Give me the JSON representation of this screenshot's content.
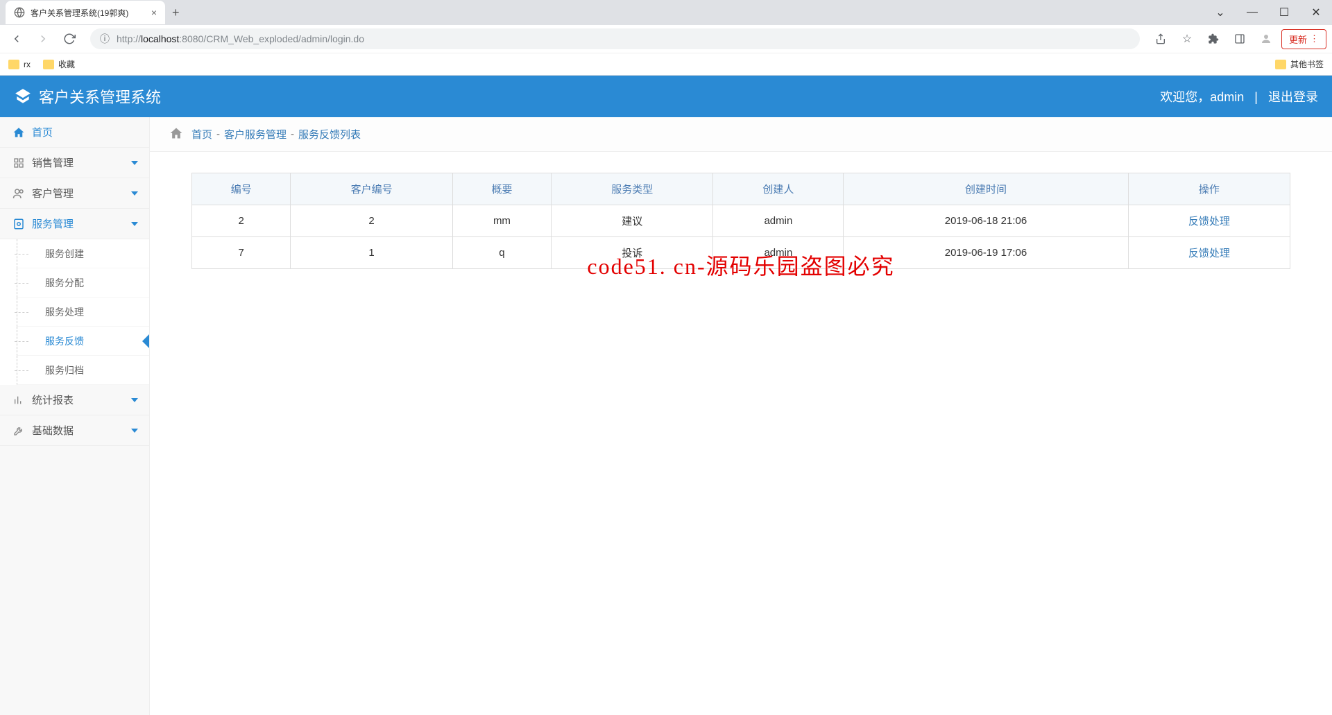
{
  "browser": {
    "tab_title": "客户关系管理系统(19郭爽)",
    "url_prefix": "http://",
    "url_host": "localhost",
    "url_port": ":8080",
    "url_path": "/CRM_Web_exploded/admin/login.do",
    "update_label": "更新",
    "bookmarks": [
      "rx",
      "收藏"
    ],
    "other_bookmarks": "其他书签"
  },
  "header": {
    "app_title": "客户关系管理系统",
    "welcome": "欢迎您，",
    "username": "admin",
    "logout": "退出登录"
  },
  "sidebar": {
    "home": "首页",
    "sales": "销售管理",
    "customer": "客户管理",
    "service": "服务管理",
    "service_sub": {
      "create": "服务创建",
      "assign": "服务分配",
      "process": "服务处理",
      "feedback": "服务反馈",
      "archive": "服务归档"
    },
    "stats": "统计报表",
    "basic": "基础数据"
  },
  "breadcrumb": {
    "home": "首页",
    "section": "客户服务管理",
    "page": "服务反馈列表"
  },
  "table": {
    "headers": {
      "id": "编号",
      "customer_id": "客户编号",
      "summary": "概要",
      "type": "服务类型",
      "creator": "创建人",
      "created_at": "创建时间",
      "action": "操作"
    },
    "rows": [
      {
        "id": "2",
        "customer_id": "2",
        "summary": "mm",
        "type": "建议",
        "creator": "admin",
        "created_at": "2019-06-18 21:06",
        "action": "反馈处理"
      },
      {
        "id": "7",
        "customer_id": "1",
        "summary": "q",
        "type": "投诉",
        "creator": "admin",
        "created_at": "2019-06-19 17:06",
        "action": "反馈处理"
      }
    ]
  },
  "watermark": "code51. cn-源码乐园盗图必究"
}
